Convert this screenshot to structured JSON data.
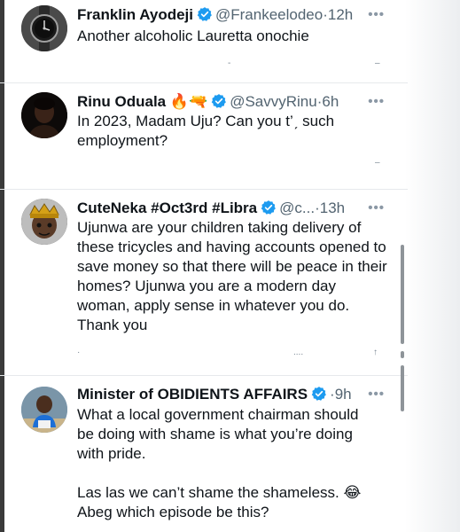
{
  "tweets": [
    {
      "name": "Franklin Ayodeji",
      "handle": "@Frankeelodeo",
      "time": "12h",
      "text": "Another alcoholic Lauretta onochie",
      "avatar_icon": "wristwatch-avatar",
      "verified": true
    },
    {
      "name": "Rinu Oduala",
      "emoji": "🔥🔫",
      "handle": "@SavvyRinu",
      "time": "6h",
      "text_line1": "In 2023, Madam Uju? Can you t’ˏ  such",
      "text_line2": "employment?",
      "avatar_icon": "portrait-avatar",
      "verified": true
    },
    {
      "name": "CuteNeka #Oct3rd #Libra",
      "handle": "@c...",
      "time": "13h",
      "text": "Ujunwa are your children taking delivery of these tricycles and having accounts opened to save money so that there will be peace in their homes? Ujunwa you are a modern day woman, apply sense in whatever you do. Thank you",
      "avatar_icon": "crowned-avatar",
      "verified": true
    },
    {
      "name": "Minister of OBIDIENTS AFFAIRS",
      "handle": "",
      "time": "9h",
      "text_p1": "What a local government chairman should be doing with shame is what you’re doing with pride.",
      "text_p2_line1": "Las las we can’t shame the shameless. 😂",
      "text_p2_line2": "Abeg which episode be this?",
      "avatar_icon": "child-avatar",
      "verified": true
    }
  ],
  "ui": {
    "separator_dot": "·",
    "more_label": "•••",
    "verified_color": "#1d9bf0",
    "accent_color": "#1d9bf0"
  }
}
